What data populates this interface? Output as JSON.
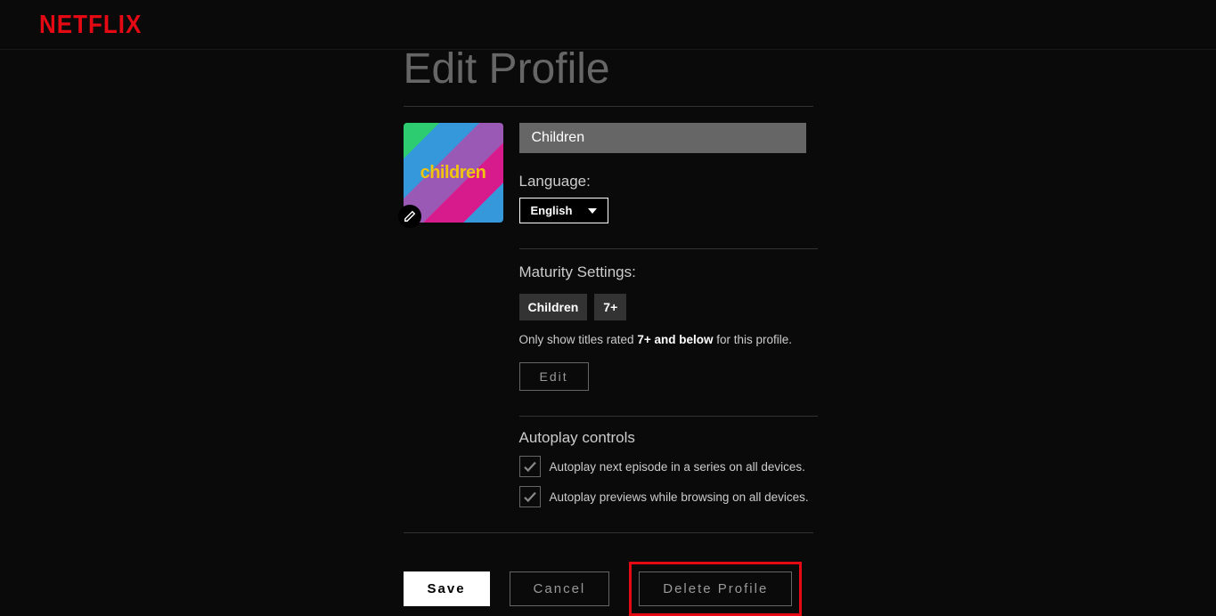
{
  "brand": "NETFLIX",
  "page_title": "Edit Profile",
  "avatar_label": "children",
  "profile_name": "Children",
  "language": {
    "label": "Language:",
    "value": "English"
  },
  "maturity": {
    "heading": "Maturity Settings:",
    "tags": [
      "Children",
      "7+"
    ],
    "note_prefix": "Only show titles rated ",
    "note_bold": "7+ and below",
    "note_suffix": " for this profile.",
    "edit_label": "Edit"
  },
  "autoplay": {
    "heading": "Autoplay controls",
    "opt1": "Autoplay next episode in a series on all devices.",
    "opt2": "Autoplay previews while browsing on all devices."
  },
  "actions": {
    "save": "Save",
    "cancel": "Cancel",
    "delete": "Delete Profile"
  }
}
